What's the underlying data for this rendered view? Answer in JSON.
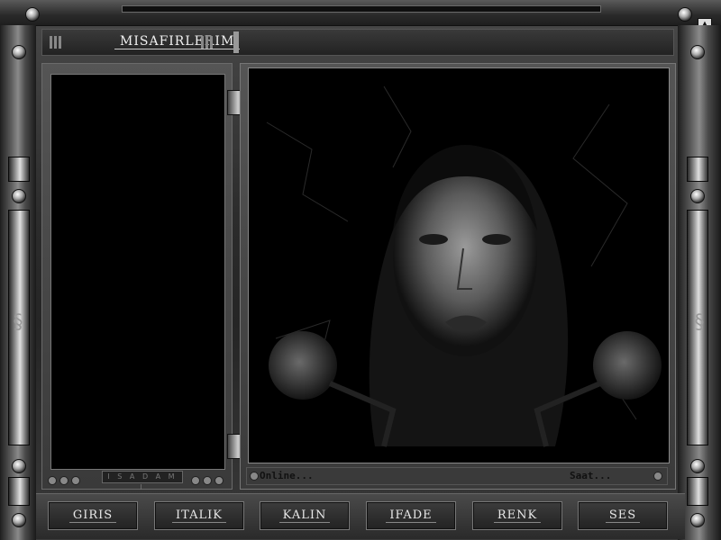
{
  "window": {
    "title": "MISAFIRLERIM"
  },
  "sidebar": {
    "footer_label": "I S A D A M I"
  },
  "status": {
    "online_label": "Online...",
    "time_label": "Saat..."
  },
  "toolbar": {
    "buttons": [
      {
        "label": "GIRIS"
      },
      {
        "label": "ITALIK"
      },
      {
        "label": "KALIN"
      },
      {
        "label": "IFADE"
      },
      {
        "label": "RENK"
      },
      {
        "label": "SES"
      }
    ]
  },
  "icons": {
    "left_ornament": "scroll-ornament-icon",
    "right_ornament": "scroll-ornament-icon",
    "close": "arrow-icon"
  },
  "colors": {
    "frame": "#3a3a3a",
    "panel": "#000000",
    "text": "#f0f0f0"
  }
}
